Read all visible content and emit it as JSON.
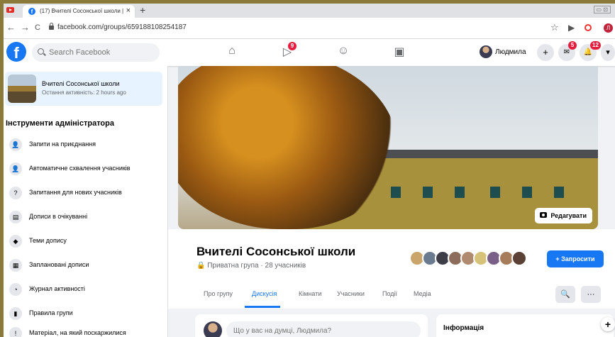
{
  "browser": {
    "tab_title": "(17) Вчителі Сосонської школи | F",
    "tab_close": "×",
    "new_tab": "+",
    "url": "facebook.com/groups/659188108254187",
    "back": "←",
    "forward": "→",
    "reload": "C",
    "star": "☆",
    "window_controls": "▭ ⊡",
    "profile_letter": "Л"
  },
  "fbnav": {
    "logo": "f",
    "search_placeholder": "Search Facebook",
    "watch_badge": "9",
    "user_name": "Людмила",
    "create": "+",
    "messenger_badge": "5",
    "notifications_badge": "12",
    "menu": "▾",
    "home_icon": "⌂",
    "watch_icon": "▷",
    "groups_icon": "☺",
    "gaming_icon": "▣",
    "messenger_icon": "✉",
    "bell_icon": "🔔"
  },
  "sidebar": {
    "group_name": "Вчителі Сосонської школи",
    "group_activity": "Остання активність: 2 hours ago",
    "admin_title": "Інструменти адміністратора",
    "items": [
      {
        "label": "Запити на приєднання",
        "icon": "👤"
      },
      {
        "label": "Автоматичне схвалення учасників",
        "icon": "👤"
      },
      {
        "label": "Запитання для нових учасників",
        "icon": "?"
      },
      {
        "label": "Дописи в очікуванні",
        "icon": "▤"
      },
      {
        "label": "Теми допису",
        "icon": "◆"
      },
      {
        "label": "Заплановані дописи",
        "icon": "▦"
      },
      {
        "label": "Журнал активності",
        "icon": "◔"
      },
      {
        "label": "Правила групи",
        "icon": "▮"
      },
      {
        "label": "Матеріал, на який поскаржилися",
        "icon": "!"
      }
    ]
  },
  "cover": {
    "edit_label": "Редагувати"
  },
  "group": {
    "title": "Вчителі Сосонської школи",
    "meta": "🔒 Приватна група · 28 учасників",
    "invite_label": "+ Запросити"
  },
  "tabs": [
    "Про групу",
    "Дискусія",
    "Кімнати",
    "Учасники",
    "Події",
    "Медіа"
  ],
  "actions": {
    "search": "🔍",
    "more": "···"
  },
  "composer": {
    "placeholder": "Що у вас на думці, Людмила?"
  },
  "info": {
    "title": "Інформація"
  },
  "fab": "+",
  "colors": {
    "accent": "#1877f2",
    "badge": "#e41e3f"
  }
}
